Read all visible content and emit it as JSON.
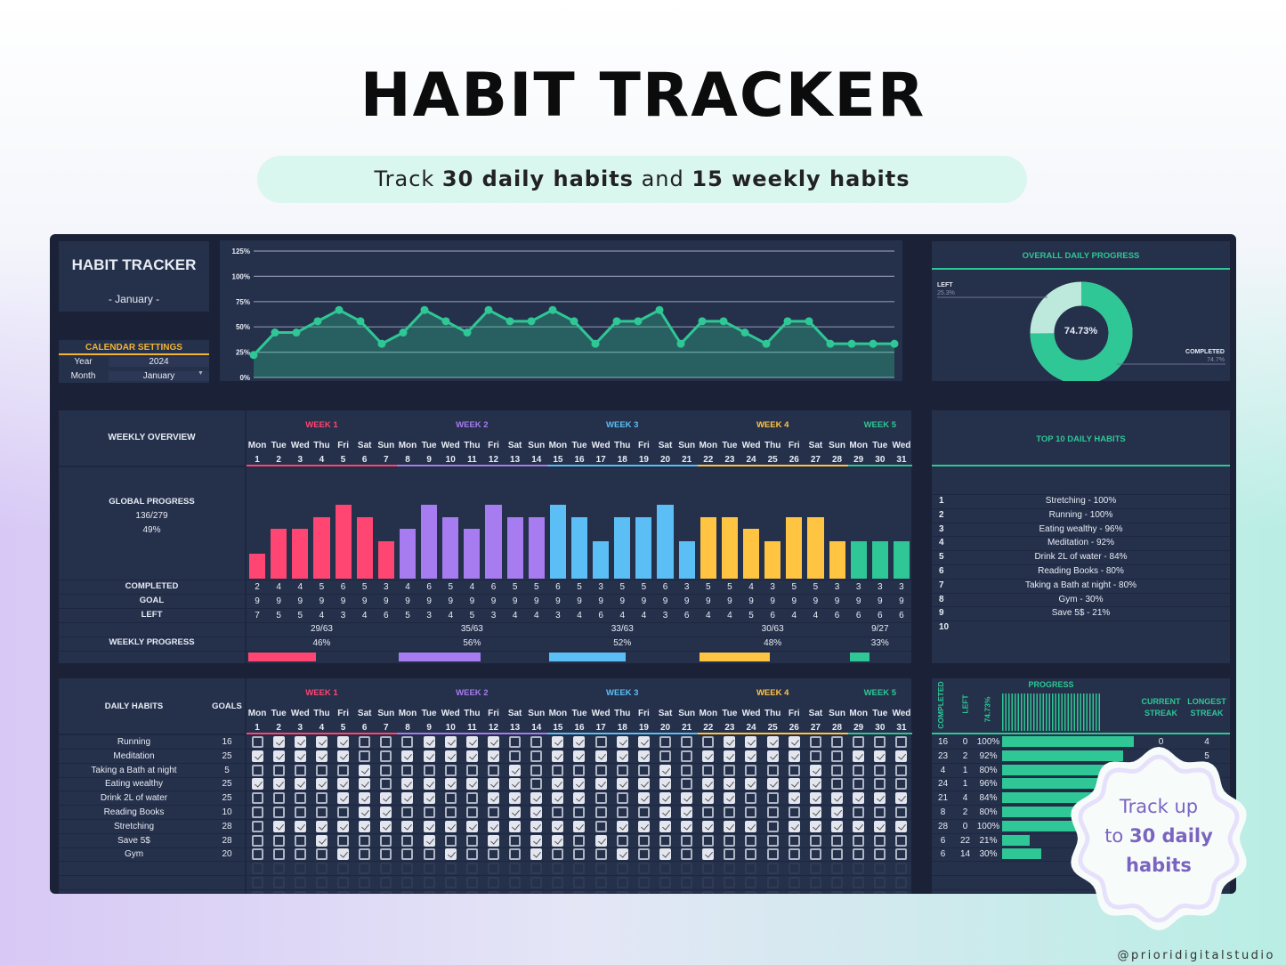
{
  "header": {
    "title": "HABIT TRACKER",
    "subtitle_parts": [
      "Track ",
      "30 daily habits",
      " and ",
      "15 weekly habits"
    ]
  },
  "dashboard": {
    "title": "HABIT TRACKER",
    "month_label": "- January -",
    "calendar": {
      "heading": "CALENDAR SETTINGS",
      "year_label": "Year",
      "year": "2024",
      "month_label": "Month",
      "month": "January"
    },
    "overall": {
      "heading": "OVERALL DAILY PROGRESS",
      "center": "74.73%",
      "left_label": "LEFT",
      "left_pct": "25.3%",
      "completed_label": "COMPLETED",
      "completed_pct": "74.7%",
      "completed_value": 74.73
    },
    "weekly": {
      "heading": "WEEKLY OVERVIEW",
      "global_label": "GLOBAL PROGRESS",
      "global_fraction": "136/279",
      "global_pct": "49%",
      "completed_label": "COMPLETED",
      "goal_label": "GOAL",
      "left_label": "LEFT",
      "weekly_progress_label": "WEEKLY PROGRESS"
    },
    "weeks": [
      {
        "label": "WEEK 1",
        "color": "#ff4571",
        "fraction": "29/63",
        "pct": "46%",
        "value": 46
      },
      {
        "label": "WEEK 2",
        "color": "#a67cf0",
        "fraction": "35/63",
        "pct": "56%",
        "value": 56
      },
      {
        "label": "WEEK 3",
        "color": "#5bbff5",
        "fraction": "33/63",
        "pct": "52%",
        "value": 52
      },
      {
        "label": "WEEK 4",
        "color": "#ffc542",
        "fraction": "30/63",
        "pct": "48%",
        "value": 48
      },
      {
        "label": "WEEK 5",
        "color": "#2ec795",
        "fraction": "9/27",
        "pct": "33%",
        "value": 33
      }
    ],
    "day_names": [
      "Mon",
      "Tue",
      "Wed",
      "Thu",
      "Fri",
      "Sat",
      "Sun"
    ],
    "completed": [
      2,
      4,
      4,
      5,
      6,
      5,
      3,
      4,
      6,
      5,
      4,
      6,
      5,
      5,
      6,
      5,
      3,
      5,
      5,
      6,
      3,
      5,
      5,
      4,
      3,
      5,
      5,
      3,
      3,
      3,
      3
    ],
    "goal": [
      9,
      9,
      9,
      9,
      9,
      9,
      9,
      9,
      9,
      9,
      9,
      9,
      9,
      9,
      9,
      9,
      9,
      9,
      9,
      9,
      9,
      9,
      9,
      9,
      9,
      9,
      9,
      9,
      9,
      9,
      9
    ],
    "left": [
      7,
      5,
      5,
      4,
      3,
      4,
      6,
      5,
      3,
      4,
      5,
      3,
      4,
      4,
      3,
      4,
      6,
      4,
      4,
      3,
      6,
      4,
      4,
      5,
      6,
      4,
      4,
      6,
      6,
      6,
      6
    ],
    "top10": {
      "heading": "TOP 10 DAILY HABITS",
      "items": [
        "Stretching - 100%",
        "Running - 100%",
        "Eating wealthy - 96%",
        "Meditation - 92%",
        "Drink 2L of water - 84%",
        "Reading Books - 80%",
        "Taking a Bath at night - 80%",
        "Gym - 30%",
        "Save 5$ - 21%",
        ""
      ]
    },
    "daily": {
      "heading": "DAILY HABITS",
      "goals_heading": "GOALS"
    },
    "stats": {
      "completed_heading": "COMPLETED",
      "left_heading": "LEFT",
      "pct_heading": "74.73%",
      "progress_heading": "PROGRESS",
      "current_heading": "CURRENT STREAK",
      "longest_heading": "LONGEST STREAK"
    },
    "habits": [
      {
        "name": "Running",
        "goal": "16",
        "checked": [
          2,
          3,
          4,
          5,
          9,
          10,
          11,
          12,
          15,
          16,
          18,
          19,
          23,
          24,
          25,
          26
        ],
        "completed": "16",
        "left": "0",
        "pct": "100%",
        "value": 100,
        "current_streak": "0",
        "longest_streak": "4"
      },
      {
        "name": "Meditation",
        "goal": "25",
        "checked": [
          1,
          2,
          3,
          4,
          5,
          8,
          9,
          10,
          11,
          12,
          15,
          16,
          17,
          18,
          19,
          22,
          23,
          24,
          25,
          26,
          29,
          30,
          31
        ],
        "completed": "23",
        "left": "2",
        "pct": "92%",
        "value": 92,
        "longest_streak": "5"
      },
      {
        "name": "Taking a Bath at night",
        "goal": "5",
        "checked": [
          6,
          13,
          20,
          27
        ],
        "completed": "4",
        "left": "1",
        "pct": "80%",
        "value": 80
      },
      {
        "name": "Eating wealthy",
        "goal": "25",
        "checked": [
          1,
          2,
          3,
          4,
          5,
          6,
          8,
          9,
          10,
          11,
          12,
          13,
          15,
          16,
          17,
          18,
          19,
          20,
          22,
          23,
          24,
          25,
          26,
          27
        ],
        "completed": "24",
        "left": "1",
        "pct": "96%",
        "value": 96
      },
      {
        "name": "Drink 2L of water",
        "goal": "25",
        "checked": [
          5,
          6,
          7,
          8,
          9,
          12,
          13,
          14,
          15,
          16,
          19,
          20,
          21,
          22,
          23,
          26,
          27,
          28,
          29,
          30,
          31
        ],
        "completed": "21",
        "left": "4",
        "pct": "84%",
        "value": 84
      },
      {
        "name": "Reading Books",
        "goal": "10",
        "checked": [
          6,
          7,
          13,
          14,
          20,
          21,
          27,
          28
        ],
        "completed": "8",
        "left": "2",
        "pct": "80%",
        "value": 80
      },
      {
        "name": "Stretching",
        "goal": "28",
        "checked": [
          2,
          3,
          4,
          5,
          6,
          7,
          8,
          9,
          10,
          11,
          12,
          13,
          14,
          15,
          16,
          18,
          19,
          20,
          21,
          22,
          23,
          24,
          26,
          27,
          28,
          29,
          30,
          31
        ],
        "completed": "28",
        "left": "0",
        "pct": "100%",
        "value": 100
      },
      {
        "name": "Save 5$",
        "goal": "28",
        "checked": [
          4,
          9,
          12,
          14,
          15,
          17
        ],
        "completed": "6",
        "left": "22",
        "pct": "21%",
        "value": 21
      },
      {
        "name": "Gym",
        "goal": "20",
        "checked": [
          5,
          10,
          14,
          18,
          20,
          22
        ],
        "completed": "6",
        "left": "14",
        "pct": "30%",
        "value": 30
      }
    ]
  },
  "badge": {
    "line1": "Track up",
    "line2a": "to ",
    "line2b": "30 daily",
    "line3": "habits"
  },
  "watermark": "@prioridigitalstudio",
  "chart_data": [
    {
      "type": "area",
      "x": [
        1,
        2,
        3,
        4,
        5,
        6,
        7,
        8,
        9,
        10,
        11,
        12,
        13,
        14,
        15,
        16,
        17,
        18,
        19,
        20,
        21,
        22,
        23,
        24,
        25,
        26,
        27,
        28,
        29,
        30,
        31
      ],
      "y": [
        22.2,
        44.4,
        44.4,
        55.6,
        66.7,
        55.6,
        33.3,
        44.4,
        66.7,
        55.6,
        44.4,
        66.7,
        55.6,
        55.6,
        66.7,
        55.6,
        33.3,
        55.6,
        55.6,
        66.7,
        33.3,
        55.6,
        55.6,
        44.4,
        33.3,
        55.6,
        55.6,
        33.3,
        33.3,
        33.3,
        33.3
      ],
      "yticks": [
        "0%",
        "25%",
        "50%",
        "75%",
        "100%",
        "125%"
      ],
      "ylim": [
        0,
        125
      ],
      "grid": true,
      "color": "#2ec795"
    },
    {
      "type": "bar",
      "categories": [
        1,
        2,
        3,
        4,
        5,
        6,
        7,
        8,
        9,
        10,
        11,
        12,
        13,
        14,
        15,
        16,
        17,
        18,
        19,
        20,
        21,
        22,
        23,
        24,
        25,
        26,
        27,
        28,
        29,
        30,
        31
      ],
      "values": [
        2,
        4,
        4,
        5,
        6,
        5,
        3,
        4,
        6,
        5,
        4,
        6,
        5,
        5,
        6,
        5,
        3,
        5,
        5,
        6,
        3,
        5,
        5,
        4,
        3,
        5,
        5,
        3,
        3,
        3,
        3
      ],
      "ylim": [
        0,
        9
      ]
    },
    {
      "type": "pie",
      "categories": [
        "COMPLETED",
        "LEFT"
      ],
      "values": [
        74.7,
        25.3
      ],
      "colors": [
        "#2ec795",
        "#bde9dc"
      ]
    }
  ]
}
